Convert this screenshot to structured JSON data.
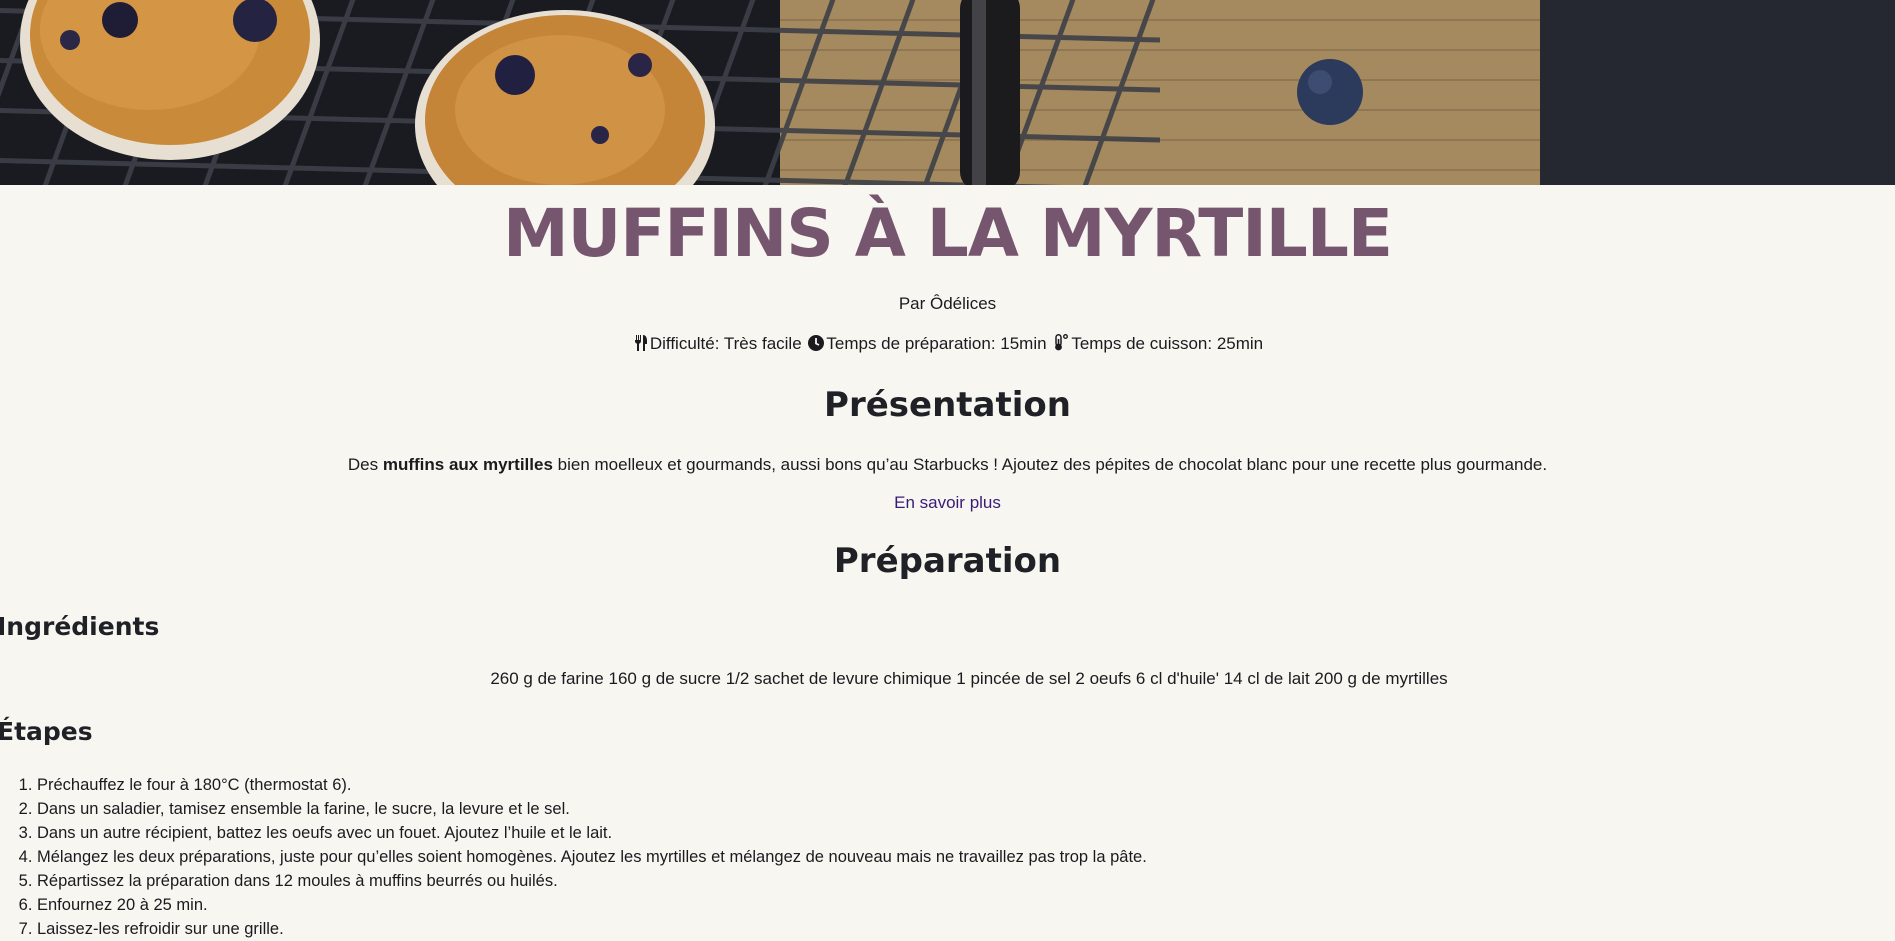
{
  "hero": {
    "image_alt": "blueberry-muffins-on-cooling-rack"
  },
  "recipe": {
    "title": "MUFFINS À LA MYRTILLE",
    "author": "Par Ôdélices",
    "difficulty": "Difficulté: Très facile",
    "prep_time": "Temps de préparation: 15min",
    "cook_time": "Temps de cuisson: 25min"
  },
  "presentation": {
    "heading": "Présentation",
    "intro_before": "Des ",
    "intro_bold": "muffins aux myrtilles",
    "intro_after": " bien moelleux et gourmands, aussi bons qu’au Starbucks ! Ajoutez des pépites de chocolat blanc pour une recette plus gourmande.",
    "more_link": "En savoir plus"
  },
  "preparation": {
    "heading": "Préparation",
    "ingredients_heading": "Ingrédients",
    "ingredients": [
      "260 g de farine",
      "160 g de sucre",
      "1/2 sachet de levure chimique",
      "1 pincée de sel",
      "2 oeufs",
      "6 cl d'huile'",
      "14 cl de lait",
      "200 g de myrtilles"
    ],
    "steps_heading": "Étapes",
    "steps": [
      "Préchauffez le four à 180°C (thermostat 6).",
      "Dans un saladier, tamisez ensemble la farine, le sucre, la levure et le sel.",
      "Dans un autre récipient, battez les oeufs avec un fouet. Ajoutez l’huile et le lait.",
      "Mélangez les deux préparations, juste pour qu’elles soient homogènes. Ajoutez les myrtilles et mélangez de nouveau mais ne travaillez pas trop la pâte.",
      "Répartissez la préparation dans 12 moules à muffins beurrés ou huilés.",
      "Enfournez 20 à 25 min.",
      "Laissez-les refroidir sur une grille."
    ]
  },
  "icons": {
    "difficulty": "utensils-icon",
    "prep": "clock-icon",
    "cook": "thermometer-icon"
  },
  "colors": {
    "title": "#76566e",
    "background": "#f7f6f1",
    "link": "#3a1a78"
  }
}
